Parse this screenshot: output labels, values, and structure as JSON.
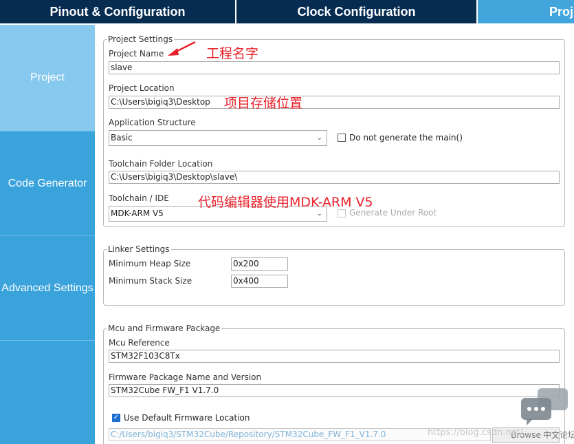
{
  "tabs": [
    {
      "label": "Pinout & Configuration"
    },
    {
      "label": "Clock Configuration"
    },
    {
      "label": "Proj"
    }
  ],
  "sidebar": {
    "items": [
      {
        "label": "Project"
      },
      {
        "label": "Code Generator"
      },
      {
        "label": "Advanced Settings"
      }
    ]
  },
  "project_settings": {
    "legend": "Project Settings",
    "project_name_label": "Project Name",
    "project_name_value": "slave",
    "project_location_label": "Project Location",
    "project_location_value": "C:\\Users\\bigiq3\\Desktop",
    "app_structure_label": "Application Structure",
    "app_structure_value": "Basic",
    "no_main_label": "Do not generate the main()",
    "toolchain_folder_label": "Toolchain Folder Location",
    "toolchain_folder_value": "C:\\Users\\bigiq3\\Desktop\\slave\\",
    "toolchain_label": "Toolchain / IDE",
    "toolchain_value": "MDK-ARM V5",
    "generate_under_root_label": "Generate Under Root"
  },
  "linker_settings": {
    "legend": "Linker Settings",
    "heap_label": "Minimum Heap Size",
    "heap_value": "0x200",
    "stack_label": "Minimum Stack Size",
    "stack_value": "0x400"
  },
  "mcu_package": {
    "legend": "Mcu and Firmware Package",
    "mcu_ref_label": "Mcu Reference",
    "mcu_ref_value": "STM32F103C8Tx",
    "fw_label": "Firmware Package Name and Version",
    "fw_value": "STM32Cube FW_F1 V1.7.0",
    "use_default_label": "Use Default Firmware Location",
    "fw_location_value": "C:/Users/bigiq3/STM32Cube/Repository/STM32Cube_FW_F1_V1.7.0",
    "browse_label": "Browse"
  },
  "annotations": {
    "project_name_note": "工程名字",
    "project_location_note": "项目存储位置",
    "toolchain_note": "代码编辑器使用MDK-ARM V5"
  },
  "watermark": {
    "url": "https://blog.csdn.net/...",
    "label": "中文论坛"
  },
  "colors": {
    "tab_dark": "#062c52",
    "tab_active": "#42a6dd",
    "sidebar": "#3aa3dc",
    "sidebar_active": "#87c9ee",
    "annotation_red": "#e8202a"
  }
}
